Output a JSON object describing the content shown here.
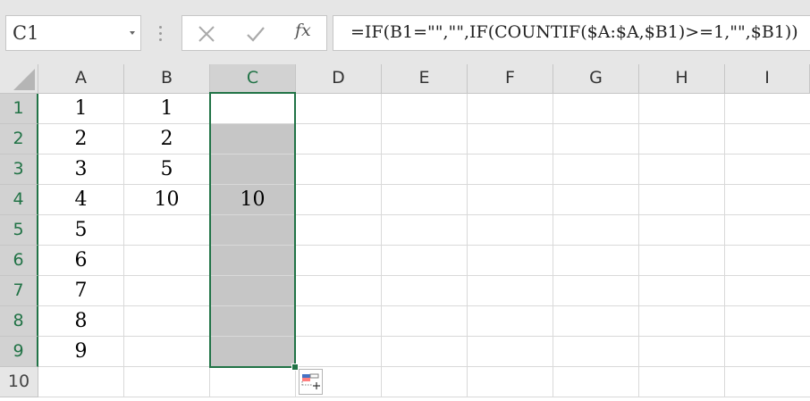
{
  "name_box": {
    "value": "C1"
  },
  "formula_bar": {
    "cancel_icon": "close-icon",
    "enter_icon": "checkmark-icon",
    "function_label": "fx",
    "formula": "=IF(B1=\"\",\"\",IF(COUNTIF($A:$A,$B1)>=1,\"\",$B1))"
  },
  "sheet": {
    "columns": [
      "A",
      "B",
      "C",
      "D",
      "E",
      "F",
      "G",
      "H",
      "I"
    ],
    "rows": [
      "1",
      "2",
      "3",
      "4",
      "5",
      "6",
      "7",
      "8",
      "9",
      "10"
    ],
    "selected_range": "C1:C9",
    "cells": {
      "A": [
        "1",
        "2",
        "3",
        "4",
        "5",
        "6",
        "7",
        "8",
        "9",
        ""
      ],
      "B": [
        "1",
        "2",
        "5",
        "10",
        "",
        "",
        "",
        "",
        "",
        ""
      ],
      "C": [
        "",
        "",
        "",
        "10",
        "",
        "",
        "",
        "",
        "",
        ""
      ]
    }
  },
  "colors": {
    "accent": "#217346",
    "selection_fill": "#c6c6c6",
    "header_bg": "#e6e6e6"
  },
  "icons": {
    "quick_analysis": "quick-analysis-icon"
  }
}
